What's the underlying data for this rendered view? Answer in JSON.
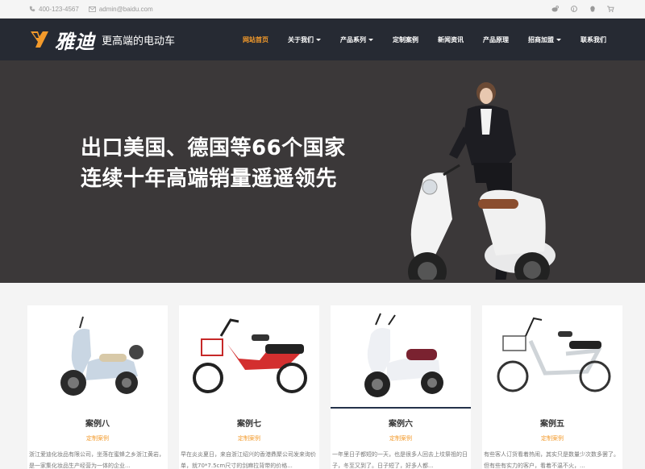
{
  "topbar": {
    "phone": "400-123-4567",
    "email": "admin@baidu.com",
    "icons": [
      "weibo-icon",
      "pinterest-icon",
      "qq-icon",
      "cart-icon"
    ]
  },
  "nav": {
    "brand": "雅迪",
    "slogan": "更高端的电动车",
    "items": [
      {
        "label": "网站首页",
        "active": true,
        "dropdown": false
      },
      {
        "label": "关于我们",
        "active": false,
        "dropdown": true
      },
      {
        "label": "产品系列",
        "active": false,
        "dropdown": true
      },
      {
        "label": "定制案例",
        "active": false,
        "dropdown": false
      },
      {
        "label": "新闻资讯",
        "active": false,
        "dropdown": false
      },
      {
        "label": "产品原理",
        "active": false,
        "dropdown": false
      },
      {
        "label": "招商加盟",
        "active": false,
        "dropdown": true
      },
      {
        "label": "联系我们",
        "active": false,
        "dropdown": false
      }
    ]
  },
  "hero": {
    "line1": "出口美国、德国等66个国家",
    "line2": "连续十年高端销量遥遥领先"
  },
  "cases": [
    {
      "title": "案例八",
      "tag": "定制案例",
      "desc": "浙江爱迪化妆品有限公司，坐落在蜜蜂之乡浙江黄岩，是一家集化妆品生产经营为一体的企业..."
    },
    {
      "title": "案例七",
      "tag": "定制案例",
      "desc": "早在炎炎夏日，来自浙江绍兴的香港鼎聚公司发来询价单，就70*7.5cm尺寸的剑麻拉背带的价格..."
    },
    {
      "title": "案例六",
      "tag": "定制案例",
      "desc": "一年里日子都短的一天，也是很多人回去上坟祭祖的日子，冬至又到了。日子短了，好多人都..."
    },
    {
      "title": "案例五",
      "tag": "定制案例",
      "desc": "有些客人订货看着热闹，其实只是数量少次数多罢了。但有些有实力的客户，看着不温不火，..."
    }
  ],
  "colors": {
    "accent": "#f39a2b",
    "nav_bg": "#262a33",
    "hero_bg": "#3b3839"
  }
}
